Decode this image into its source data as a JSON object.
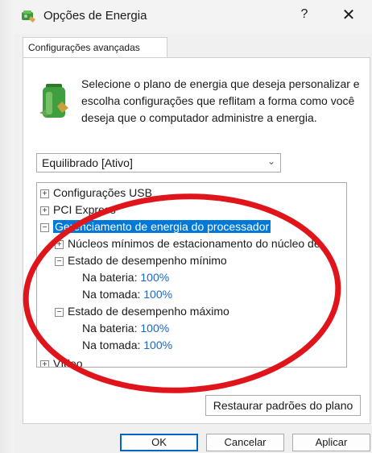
{
  "window": {
    "title": "Opções de Energia",
    "help_symbol": "?",
    "close_symbol": "✕",
    "app_icon": "power-options-icon"
  },
  "tab": {
    "label": "Configurações avançadas"
  },
  "intro": {
    "icon": "battery-plan-icon",
    "text": "Selecione o plano de energia que deseja personalizar e escolha configurações que reflitam a forma como você deseja que o computador administre a energia."
  },
  "plan_select": {
    "value": "Equilibrado [Ativo]",
    "chevron": "⌄"
  },
  "tree": {
    "items": [
      {
        "label": "Configurações USB",
        "expander": "+"
      },
      {
        "label": "PCI Express",
        "expander": "+"
      },
      {
        "label": "Gerenciamento de energia do processador",
        "expander": "−"
      },
      {
        "label": "Núcleos mínimos de estacionamento do núcleo de",
        "expander": "+"
      },
      {
        "label": "Estado de desempenho mínimo",
        "expander": "−"
      },
      {
        "label": "Na bateria:",
        "value": "100%"
      },
      {
        "label": "Na tomada:",
        "value": "100%"
      },
      {
        "label": "Estado de desempenho máximo",
        "expander": "−"
      },
      {
        "label": "Na bateria:",
        "value": "100%"
      },
      {
        "label": "Na tomada:",
        "value": "100%"
      },
      {
        "label": "Vídeo",
        "expander": "+"
      }
    ]
  },
  "buttons": {
    "restore": "Restaurar padrões do plano",
    "ok": "OK",
    "cancel": "Cancelar",
    "apply": "Aplicar"
  },
  "colors": {
    "selection": "#0078d7",
    "value_text": "#1a66cc",
    "annotation": "#e0151b"
  }
}
